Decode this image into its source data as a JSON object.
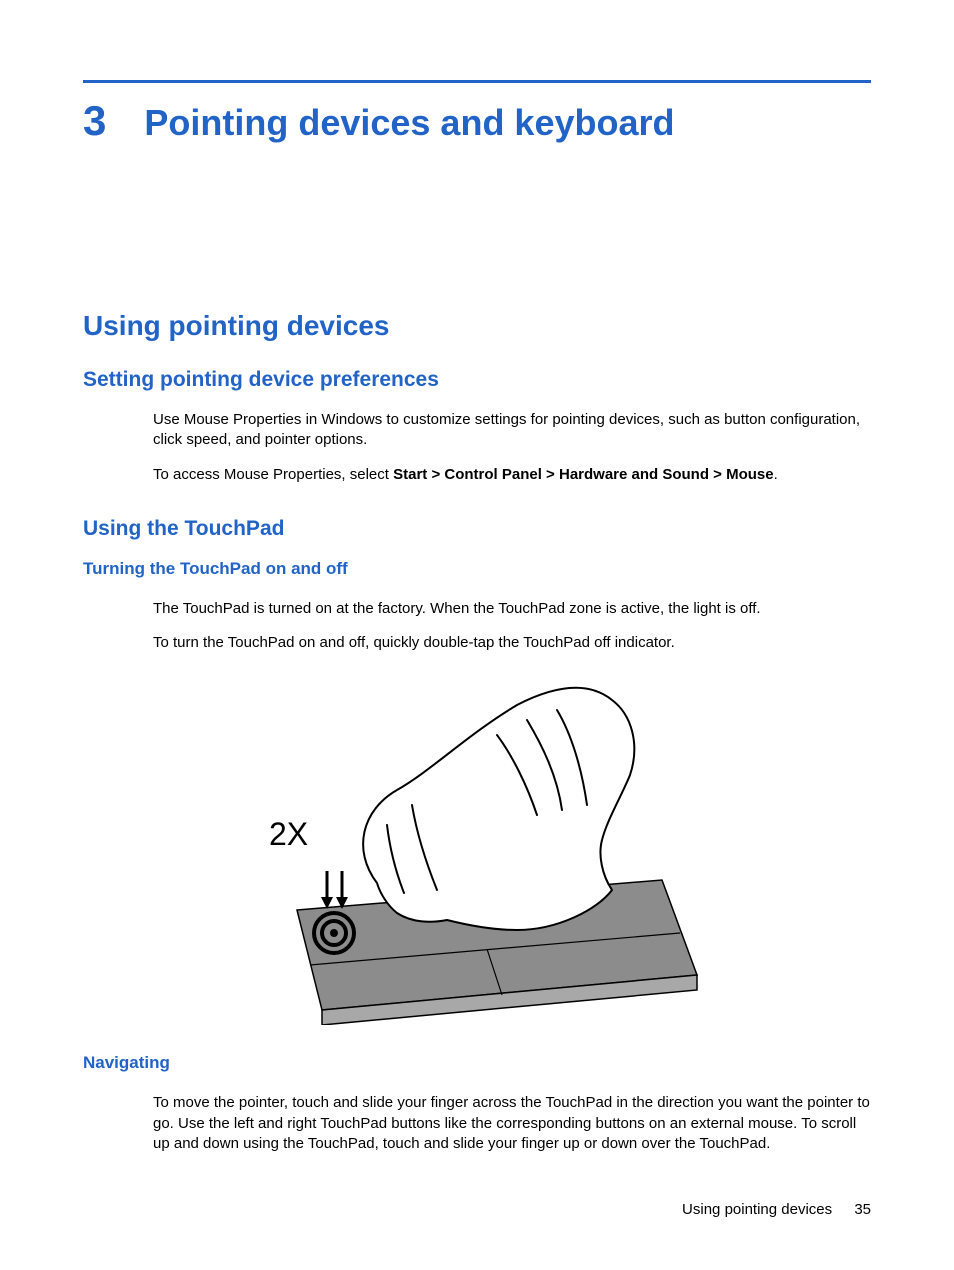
{
  "chapter": {
    "number": "3",
    "title": "Pointing devices and keyboard"
  },
  "section1": {
    "title": "Using pointing devices",
    "sub1": {
      "title": "Setting pointing device preferences",
      "p1": "Use Mouse Properties in Windows to customize settings for pointing devices, such as button configuration, click speed, and pointer options.",
      "p2_prefix": "To access Mouse Properties, select ",
      "p2_bold": "Start > Control Panel > Hardware and Sound > Mouse",
      "p2_suffix": "."
    },
    "sub2": {
      "title": "Using the TouchPad",
      "sub2a": {
        "title": "Turning the TouchPad on and off",
        "p1": "The TouchPad is turned on at the factory. When the TouchPad zone is active, the light is off.",
        "p2": "To turn the TouchPad on and off, quickly double-tap the TouchPad off indicator.",
        "illustration_label": "2X"
      },
      "sub2b": {
        "title": "Navigating",
        "p1": "To move the pointer, touch and slide your finger across the TouchPad in the direction you want the pointer to go. Use the left and right TouchPad buttons like the corresponding buttons on an external mouse. To scroll up and down using the TouchPad, touch and slide your finger up or down over the TouchPad."
      }
    }
  },
  "footer": {
    "text": "Using pointing devices",
    "page": "35"
  }
}
